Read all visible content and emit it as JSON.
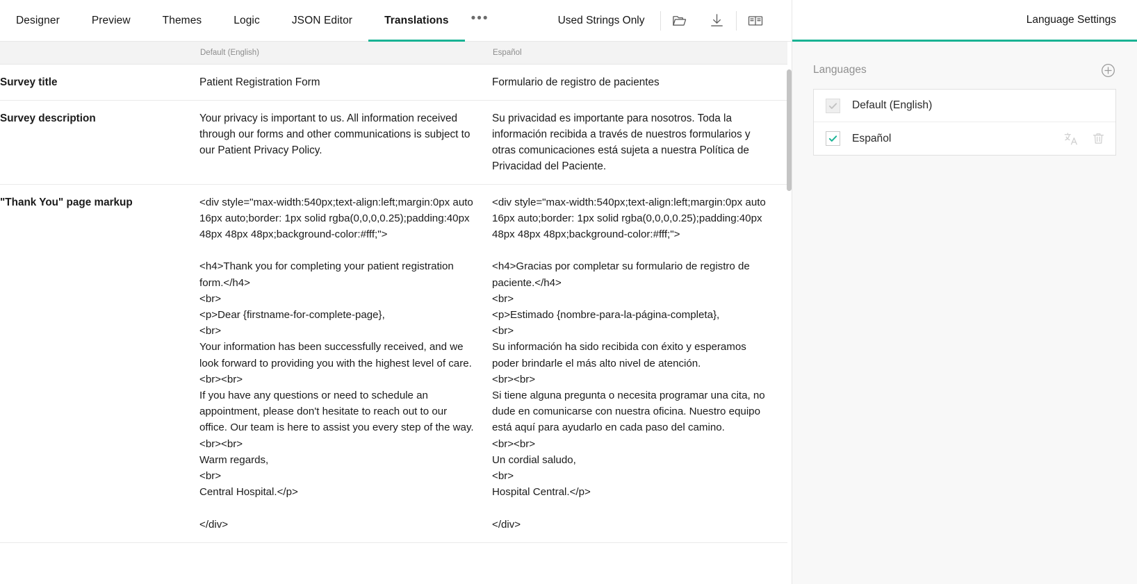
{
  "tabs": [
    {
      "label": "Designer",
      "active": false
    },
    {
      "label": "Preview",
      "active": false
    },
    {
      "label": "Themes",
      "active": false
    },
    {
      "label": "Logic",
      "active": false
    },
    {
      "label": "JSON Editor",
      "active": false
    },
    {
      "label": "Translations",
      "active": true
    }
  ],
  "tab_overflow": "•••",
  "toolbar": {
    "used_strings_label": "Used Strings Only",
    "open_icon": "folder-open-icon",
    "download_icon": "download-icon",
    "dictionary_icon": "book-icon"
  },
  "table": {
    "headers": {
      "label_col": "",
      "default_col": "Default (English)",
      "translation_col": "Español"
    },
    "rows": [
      {
        "label": "Survey title",
        "default": "Patient Registration Form",
        "translation": "Formulario de registro de pacientes"
      },
      {
        "label": "Survey description",
        "default": "Your privacy is important to us. All information received through our forms and other communications is subject to our Patient Privacy Policy.",
        "translation": "Su privacidad es importante para nosotros. Toda la información recibida a través de nuestros formularios y otras comunicaciones está sujeta a nuestra Política de Privacidad del Paciente."
      },
      {
        "label": "\"Thank You\" page markup",
        "default": "<div style=\"max-width:540px;text-align:left;margin:0px auto 16px auto;border: 1px solid rgba(0,0,0,0.25);padding:40px 48px 48px 48px;background-color:#fff;\">\n\n<h4>Thank you for completing your patient registration form.</h4>\n<br>\n<p>Dear {firstname-for-complete-page},\n<br>\nYour information has been successfully received, and we look forward to providing you with the highest level of care.\n<br><br>\nIf you have any questions or need to schedule an appointment, please don't hesitate to reach out to our office. Our team is here to assist you every step of the way.\n<br><br>\nWarm regards,\n<br>\nCentral Hospital.</p>\n\n</div>",
        "translation": "<div style=\"max-width:540px;text-align:left;margin:0px auto 16px auto;border: 1px solid rgba(0,0,0,0.25);padding:40px 48px 48px 48px;background-color:#fff;\">\n\n<h4>Gracias por completar su formulario de registro de paciente.</h4>\n<br>\n<p>Estimado {nombre-para-la-página-completa},\n<br>\nSu información ha sido recibida con éxito y esperamos poder brindarle el más alto nivel de atención.\n<br><br>\nSi tiene alguna pregunta o necesita programar una cita, no dude en comunicarse con nuestra oficina. Nuestro equipo está aquí para ayudarlo en cada paso del camino.\n<br><br>\nUn cordial saludo,\n<br>\nHospital Central.</p>\n\n</div>"
      }
    ]
  },
  "right_panel": {
    "title": "Language Settings",
    "section_label": "Languages",
    "add_icon": "plus-circle-icon",
    "languages": [
      {
        "name": "Default (English)",
        "checked": true,
        "disabled": true,
        "translate_icon": "",
        "delete_icon": ""
      },
      {
        "name": "Español",
        "checked": true,
        "disabled": false,
        "translate_icon": "translate-icon",
        "delete_icon": "trash-icon"
      }
    ]
  },
  "colors": {
    "accent": "#19b394",
    "header_bg": "#f3f3f3",
    "panel_bg": "#f8f8f8",
    "text": "#161616",
    "muted": "#8c8c8c"
  }
}
